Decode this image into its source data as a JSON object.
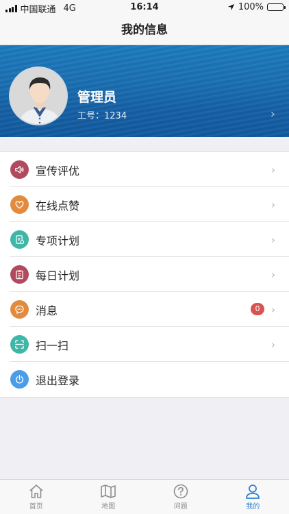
{
  "status_bar": {
    "carrier": "中国联通",
    "network": "4G",
    "time": "16:14",
    "battery": "100%"
  },
  "nav": {
    "title": "我的信息"
  },
  "profile": {
    "name": "管理员",
    "id_label": "工号：1234"
  },
  "menu": {
    "items": [
      {
        "label": "宣传评优",
        "icon": "speaker-icon",
        "color": "#b14a5e"
      },
      {
        "label": "在线点赞",
        "icon": "heart-icon",
        "color": "#e28b3f"
      },
      {
        "label": "专项计划",
        "icon": "document-icon",
        "color": "#3fb7a7"
      },
      {
        "label": "每日计划",
        "icon": "clipboard-icon",
        "color": "#b14a5e"
      },
      {
        "label": "消息",
        "icon": "chat-icon",
        "color": "#e28b3f",
        "badge": "0"
      },
      {
        "label": "扫一扫",
        "icon": "scan-icon",
        "color": "#3fb7a7"
      },
      {
        "label": "退出登录",
        "icon": "power-icon",
        "color": "#4b9de8"
      }
    ]
  },
  "tabbar": {
    "items": [
      {
        "label": "首页",
        "icon": "home-icon"
      },
      {
        "label": "地图",
        "icon": "map-icon"
      },
      {
        "label": "问题",
        "icon": "question-icon"
      },
      {
        "label": "我的",
        "icon": "user-icon",
        "active": true
      }
    ],
    "active_color": "#2a7fd3"
  }
}
